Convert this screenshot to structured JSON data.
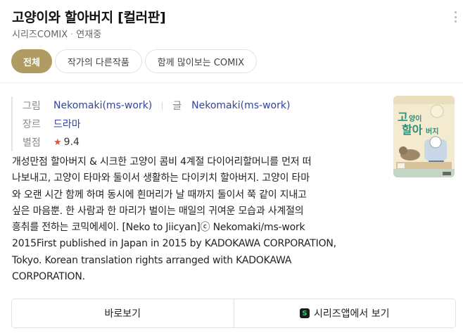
{
  "header": {
    "title": "고양이와 할아버지 [컬러판]",
    "publisher": "시리즈COMIX",
    "separator": "·",
    "status": "연재중"
  },
  "tabs": [
    {
      "label": "전체",
      "active": true
    },
    {
      "label": "작가의 다른작품",
      "active": false
    },
    {
      "label": "함께 많이보는 COMIX",
      "active": false
    }
  ],
  "meta": {
    "art_label": "그림",
    "art_value": "Nekomaki(ms-work)",
    "story_label": "글",
    "story_value": "Nekomaki(ms-work)",
    "genre_label": "장르",
    "genre_value": "드라마",
    "rating_label": "별점",
    "star": "★",
    "rating_value": "9.4"
  },
  "description_lines": [
    "개성만점 할아버지 & 시크한 고양이 콤비 4계절 다이어리할머니를 먼저 떠",
    "나보내고, 고양이 타마와 둘이서 생활하는 다이키치 할아버지. 고양이 타마",
    "와 오랜 시간 함께 하며 동시에 흰머리가 날 때까지 둘이서 쭉 같이 지내고",
    "싶은 마음뿐. 한 사람과 한 마리가 벌이는 매일의 귀여운 모습과 사계절의",
    "흥취를 전하는 코믹에세이. [Neko to Jiicyan]ⓒ Nekomaki/ms-work",
    "2015First published in Japan in 2015 by KADOKAWA CORPORATION,",
    "Tokyo. Korean translation rights arranged with KADOKAWA",
    "CORPORATION."
  ],
  "cover": {
    "title_text": "고양이와 할아버지",
    "accent": "#2f8f7a",
    "bg": "#f3ead0"
  },
  "actions": {
    "view_label": "바로보기",
    "app_icon_letter": "S",
    "app_label": "시리즈앱에서 보기"
  },
  "colors": {
    "tab_active": "#b09c63",
    "link": "#33449a",
    "star": "#e0533b",
    "app_icon_green": "#25d16b"
  }
}
